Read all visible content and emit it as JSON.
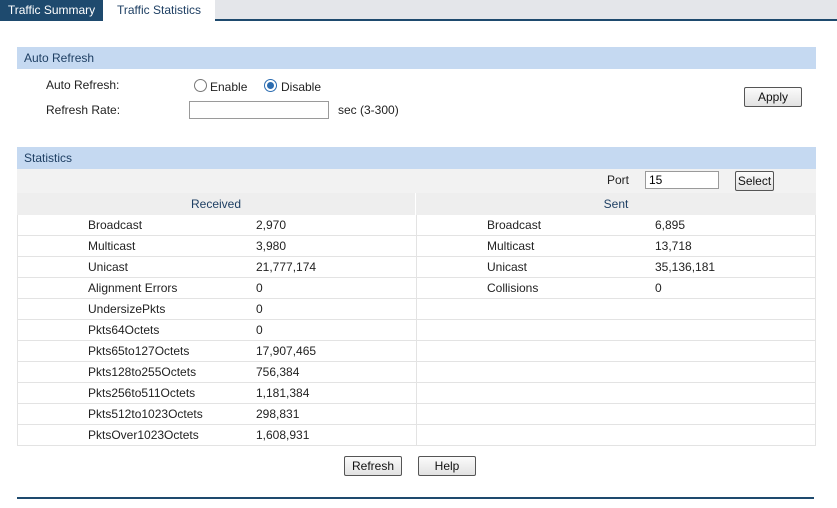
{
  "tabs": [
    {
      "label": "Traffic Summary",
      "active": true
    },
    {
      "label": "Traffic Statistics",
      "active": false
    }
  ],
  "auto_refresh": {
    "header": "Auto Refresh",
    "auto_refresh_label": "Auto Refresh:",
    "enable_label": "Enable",
    "disable_label": "Disable",
    "selected": "Disable",
    "refresh_rate_label": "Refresh Rate:",
    "refresh_rate_value": "",
    "rate_hint": "sec (3-300)",
    "apply_label": "Apply"
  },
  "statistics": {
    "header": "Statistics",
    "port_label": "Port",
    "port_value": "15",
    "select_label": "Select",
    "received_header": "Received",
    "sent_header": "Sent",
    "received": [
      {
        "name": "Broadcast",
        "value": "2,970"
      },
      {
        "name": "Multicast",
        "value": "3,980"
      },
      {
        "name": "Unicast",
        "value": "21,777,174"
      },
      {
        "name": "Alignment Errors",
        "value": "0"
      },
      {
        "name": "UndersizePkts",
        "value": "0"
      },
      {
        "name": "Pkts64Octets",
        "value": "0"
      },
      {
        "name": "Pkts65to127Octets",
        "value": "17,907,465"
      },
      {
        "name": "Pkts128to255Octets",
        "value": "756,384"
      },
      {
        "name": "Pkts256to511Octets",
        "value": "1,181,384"
      },
      {
        "name": "Pkts512to1023Octets",
        "value": "298,831"
      },
      {
        "name": "PktsOver1023Octets",
        "value": "1,608,931"
      }
    ],
    "sent": [
      {
        "name": "Broadcast",
        "value": "6,895"
      },
      {
        "name": "Multicast",
        "value": "13,718"
      },
      {
        "name": "Unicast",
        "value": "35,136,181"
      },
      {
        "name": "Collisions",
        "value": "0"
      }
    ]
  },
  "footer": {
    "refresh_label": "Refresh",
    "help_label": "Help"
  },
  "colors": {
    "accent": "#1e4a6e",
    "section_header_bg": "#c5d9f1",
    "section_header_text": "#1e3f63"
  }
}
